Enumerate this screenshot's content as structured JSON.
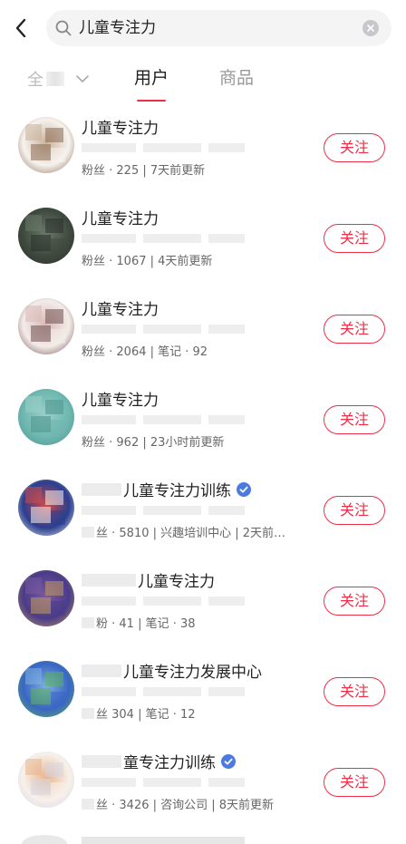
{
  "search": {
    "query": "儿童专注力",
    "back_icon": "chevron-left-icon",
    "search_icon": "search-icon",
    "clear_icon": "clear-circle-icon"
  },
  "tabs": {
    "all_label": "全",
    "user_label": "用户",
    "product_label": "商品",
    "accent": "#ee2e47"
  },
  "follow_label": "关注",
  "results": [
    {
      "name": "儿童专注力",
      "name_prefix_blur": false,
      "verified": false,
      "meta": "粉丝 · 225 | 7天前更新",
      "avatar_colors": [
        "#f6f2ee",
        "#c9b29a",
        "#8a6a52"
      ]
    },
    {
      "name": "儿童专注力",
      "name_prefix_blur": false,
      "verified": false,
      "meta": "粉丝 · 1067 | 4天前更新",
      "avatar_colors": [
        "#3f4a3e",
        "#6a7a6a",
        "#2a2f2a"
      ]
    },
    {
      "name": "儿童专注力",
      "name_prefix_blur": false,
      "verified": false,
      "meta": "粉丝 · 2064 | 笔记 · 92",
      "avatar_colors": [
        "#f3ece9",
        "#d8b8b6",
        "#6f4e50"
      ]
    },
    {
      "name": "儿童专注力",
      "name_prefix_blur": false,
      "verified": false,
      "meta": "粉丝 · 962 | 23小时前更新",
      "avatar_colors": [
        "#6fb7b0",
        "#9ad0c9",
        "#4a938c"
      ]
    },
    {
      "name": "儿童专注力训练",
      "name_prefix_blur": true,
      "verified": true,
      "meta": "丝 · 5810 | 兴趣培训中心 | 2天前…",
      "avatar_colors": [
        "#2a3f8f",
        "#d44a4a",
        "#f2f2f2"
      ]
    },
    {
      "name": "儿童专注力",
      "name_prefix_blur": true,
      "verified": false,
      "meta": "粉 · 41 | 笔记 · 38",
      "avatar_colors": [
        "#4a3c8a",
        "#7a5aa0",
        "#c29a5a"
      ]
    },
    {
      "name": "儿童专注力发展中心",
      "name_prefix_blur": true,
      "verified": false,
      "meta": "丝 304 | 笔记 · 12",
      "avatar_colors": [
        "#3a66c4",
        "#7fb0e0",
        "#5bb35a"
      ]
    },
    {
      "name": "童专注力训练",
      "name_prefix_blur": true,
      "verified": true,
      "meta": "丝 · 3426 | 咨询公司 | 8天前更新",
      "avatar_colors": [
        "#f7f0ea",
        "#e8b58a",
        "#d6d6e6"
      ]
    }
  ]
}
